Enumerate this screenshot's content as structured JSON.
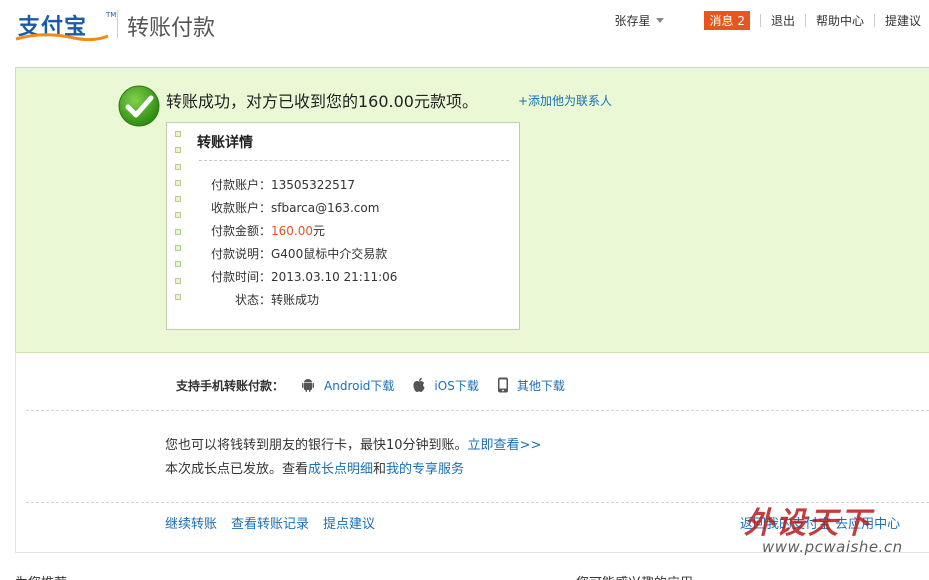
{
  "header": {
    "logo_text": "支付宝",
    "logo_tm": "TM",
    "title": "转账付款",
    "user_name": "张存星",
    "messages_label": "消息",
    "messages_count": "2",
    "logout": "退出",
    "help": "帮助中心",
    "suggest": "提建议"
  },
  "success": {
    "message": "转账成功，对方已收到您的160.00元款项。",
    "add_contact": "+添加他为联系人",
    "icon": "check-circle-icon",
    "detail_title": "转账详情",
    "rows": [
      {
        "label": "付款账户：",
        "value": "13505322517"
      },
      {
        "label": "收款账户：",
        "value": "sfbarca@163.com"
      },
      {
        "label": "付款金额：",
        "value": "160.00",
        "suffix": "元"
      },
      {
        "label": "付款说明：",
        "value": "G400鼠标中介交易款"
      },
      {
        "label": "付款时间：",
        "value": "2013.03.10 21:11:06"
      },
      {
        "label": "状态：",
        "value": "转账成功"
      }
    ]
  },
  "mobile": {
    "label": "支持手机转账付款：",
    "android": "Android下载",
    "ios": "iOS下载",
    "other": "其他下载"
  },
  "info": {
    "line1_text": "您也可以将钱转到朋友的银行卡，最快10分钟到账。",
    "line1_link": "立即查看>>",
    "line2_prefix": "本次成长点已发放。查看",
    "line2_link1": "成长点明细",
    "line2_and": "和",
    "line2_link2": "我的专享服务"
  },
  "actions": {
    "continue": "继续转账",
    "records": "查看转账记录",
    "suggest": "提点建议",
    "return": "返回我的支付宝",
    "apps": "去应用中心"
  },
  "footer": {
    "left": "为您推荐",
    "right": "您可能感兴趣的应用"
  },
  "watermark": {
    "big": "外设天下",
    "small": "www.pcwaishe.cn"
  },
  "colors": {
    "success_bg": "#eaf8d5",
    "link": "#1a6fb5",
    "accent": "#e5571e",
    "brand": "#1a5aa8"
  }
}
